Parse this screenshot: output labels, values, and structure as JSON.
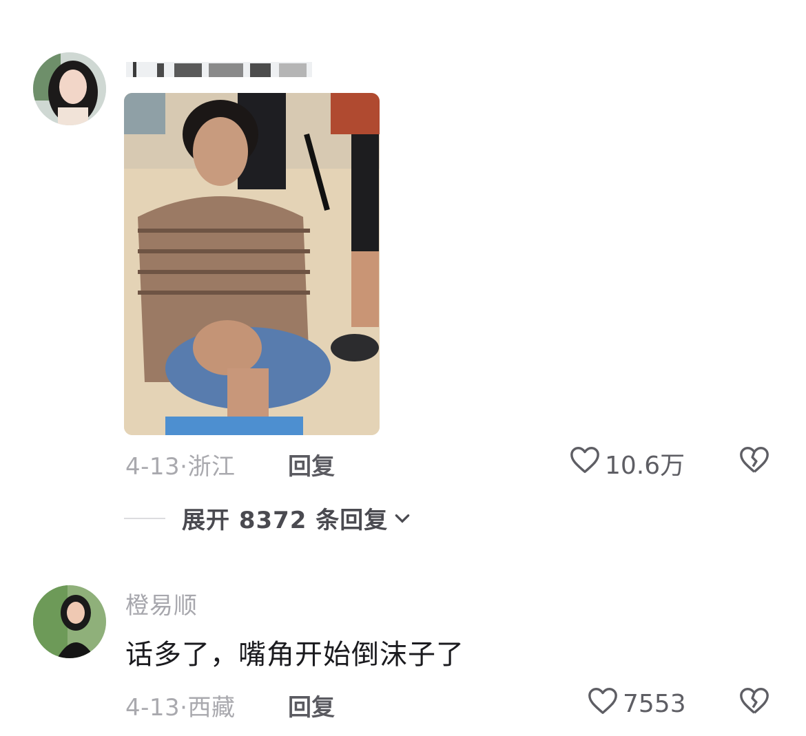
{
  "comment1": {
    "author_name": "",
    "date_location": "4-13·浙江",
    "reply_label": "回复",
    "like_count": "10.6万",
    "expand_label": "展开 8372 条回复",
    "icons": {
      "like": "heart-outline-icon",
      "dislike": "broken-heart-icon",
      "expand": "chevron-down-icon"
    }
  },
  "comment2": {
    "author_name": "橙易顺",
    "text": "话多了，嘴角开始倒沫子了",
    "date_location": "4-13·西藏",
    "reply_label": "回复",
    "like_count": "7553"
  },
  "colors": {
    "meta": "#a9a9ae",
    "text": "#1b1b1f",
    "reply": "#5a5a60"
  }
}
